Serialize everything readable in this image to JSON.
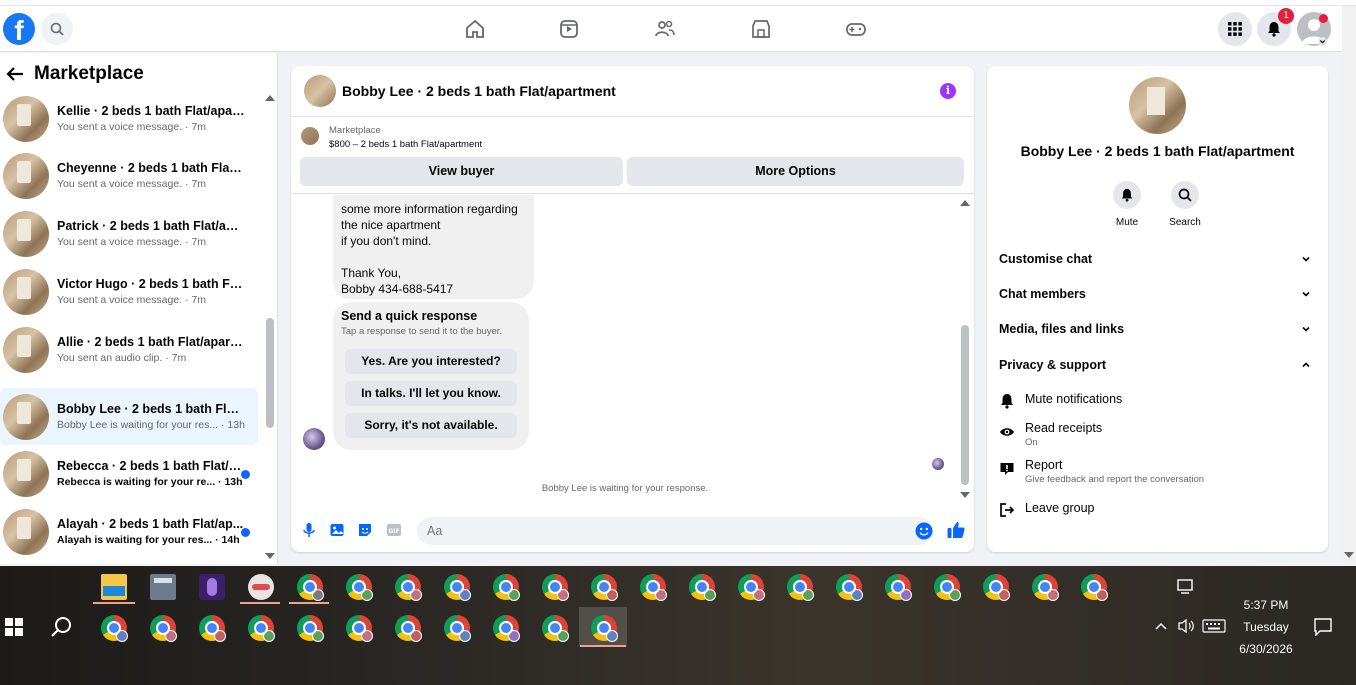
{
  "nav": {
    "logo_letter": "f",
    "notification_count": "1"
  },
  "left": {
    "title": "Marketplace",
    "conversations": [
      {
        "title": "Kellie · 2 beds 1 bath Flat/apart...",
        "sub": "You sent a voice message. · 7m",
        "unread": false
      },
      {
        "title": "Cheyenne · 2 beds 1 bath Flat/a...",
        "sub": "You sent a voice message. · 7m",
        "unread": false
      },
      {
        "title": "Patrick · 2 beds 1 bath Flat/apar...",
        "sub": "You sent a voice message. · 7m",
        "unread": false
      },
      {
        "title": "Victor Hugo · 2 beds 1 bath Flat...",
        "sub": "You sent a voice message. · 7m",
        "unread": false
      },
      {
        "title": "Allie · 2 beds 1 bath Flat/apartm...",
        "sub": "You sent an audio clip. · 7m",
        "unread": false
      },
      {
        "title": "Bobby Lee · 2 beds 1 bath Flat/a...",
        "sub": "Bobby Lee is waiting for your res... · 13h",
        "unread": false
      },
      {
        "title": "Rebecca · 2 beds 1 bath Flat/a...",
        "sub": "Rebecca is waiting for your re... · 13h",
        "unread": true
      },
      {
        "title": "Alayah · 2 beds 1 bath Flat/ap...",
        "sub": "Alayah is waiting for your res... · 14h",
        "unread": true
      }
    ]
  },
  "chat": {
    "title": "Bobby Lee · 2 beds 1 bath Flat/apartment",
    "listing_label": "Marketplace",
    "listing_price": "$800 – 2 beds 1 bath Flat/apartment",
    "view_buyer": "View buyer",
    "more_options": "More Options",
    "message_lines": [
      "some more information regarding",
      "the nice apartment",
      "if you don't mind.",
      "",
      "Thank You,",
      "Bobby 434-688-5417"
    ],
    "quick_title": "Send a quick response",
    "quick_sub": "Tap a response to send it to the buyer.",
    "quick_options": [
      "Yes. Are you interested?",
      "In talks. I'll let you know.",
      "Sorry, it's not available."
    ],
    "waiting": "Bobby Lee is waiting for your response.",
    "input_placeholder": "Aa"
  },
  "right": {
    "name": "Bobby Lee · 2 beds 1 bath Flat/apartment",
    "mute_label": "Mute",
    "search_label": "Search",
    "sections": [
      "Customise chat",
      "Chat members",
      "Media, files and links",
      "Privacy & support"
    ],
    "items": [
      {
        "title": "Mute notifications",
        "sub": ""
      },
      {
        "title": "Read receipts",
        "sub": "On"
      },
      {
        "title": "Report",
        "sub": "Give feedback and report the conversation"
      },
      {
        "title": "Leave group",
        "sub": ""
      }
    ]
  },
  "taskbar": {
    "time": "5:37 PM",
    "day": "Tuesday",
    "date": "6/30/2026"
  },
  "colors": {
    "brand": "#1877f2",
    "accent": "#0866ff",
    "info": "#a033ff",
    "badge": "#e41e3f"
  }
}
